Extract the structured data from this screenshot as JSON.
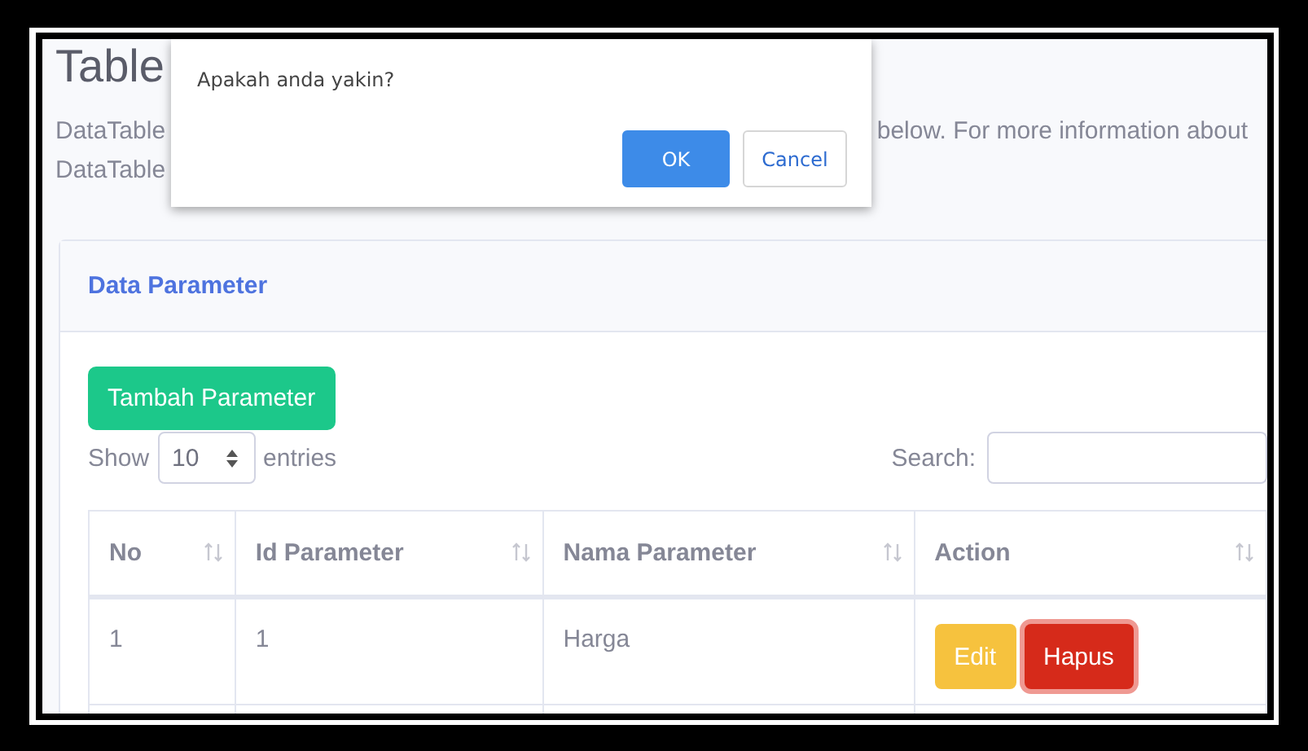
{
  "page": {
    "title": "Table",
    "description_fragments": [
      "DataTable",
      "below. For more information about",
      "DataTable"
    ]
  },
  "dialog": {
    "message": "Apakah anda yakin?",
    "buttons": [
      {
        "label": "OK",
        "kind": "primary"
      },
      {
        "label": "Cancel",
        "kind": "secondary"
      }
    ]
  },
  "card": {
    "title": "Data Parameter",
    "add_button": "Tambah Parameter",
    "length": {
      "before": "Show",
      "value": "10",
      "after": "entries"
    },
    "search": {
      "label": "Search:"
    },
    "table": {
      "columns": [
        "No",
        "Id Parameter",
        "Nama Parameter",
        "Action"
      ],
      "rows": [
        {
          "cells": [
            "1",
            "1",
            "Harga"
          ],
          "actions": [
            {
              "label": "Edit",
              "kind": "edit"
            },
            {
              "label": "Hapus",
              "kind": "delete"
            }
          ]
        }
      ]
    }
  }
}
